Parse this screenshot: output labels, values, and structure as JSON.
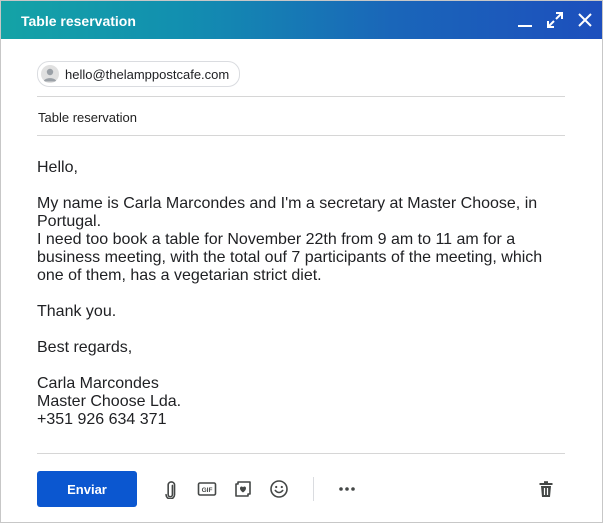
{
  "window": {
    "title": "Table reservation",
    "controls": {
      "minimize": "minimize-icon",
      "expand": "expand-icon",
      "close": "close-icon"
    }
  },
  "recipient": {
    "email": "hello@thelamppostcafe.com",
    "icon": "person-icon"
  },
  "subject": "Table reservation",
  "body": {
    "greeting": "Hello,",
    "paragraph1": "My name is Carla Marcondes and I'm a secretary at Master Choose, in Portugal.\nI need too book a table for November 22th from 9 am to 11 am for a business meeting, with the total ouf 7 participants of the meeting, which one of them, has a vegetarian strict diet.",
    "thanks": "Thank you.",
    "closing": "Best regards,",
    "signature": "Carla Marcondes\nMaster Choose Lda.\n+351 926 634 371"
  },
  "toolbar": {
    "send_label": "Enviar",
    "attach_icon": "paperclip-icon",
    "gif_icon": "gif-icon",
    "gif_label": "GIF",
    "sticker_icon": "sticker-icon",
    "emoji_icon": "emoji-icon",
    "more_icon": "more-options-icon",
    "delete_icon": "trash-icon"
  },
  "colors": {
    "titlebar_start": "#14a3a6",
    "titlebar_end": "#1d4fbd",
    "send_button": "#0b57d0",
    "icon": "#444746"
  }
}
